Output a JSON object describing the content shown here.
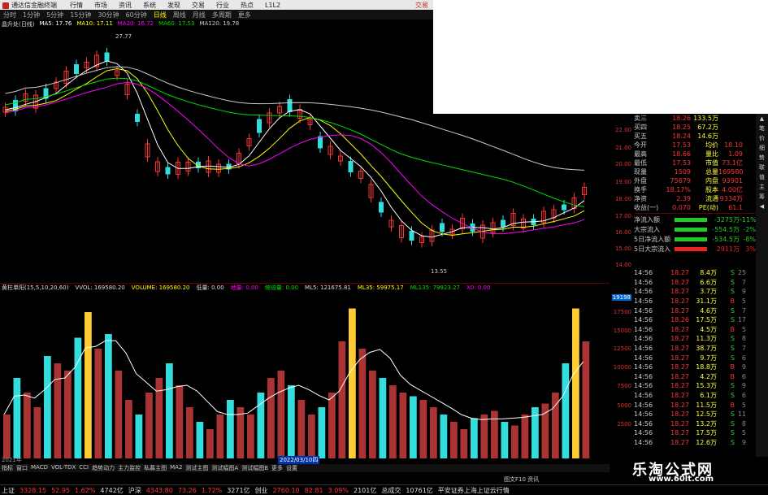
{
  "app": {
    "title": "通达信金融终端",
    "menu": [
      "行情",
      "市场",
      "资讯",
      "系统",
      "发现",
      "交易",
      "行业",
      "热点",
      "L1L2"
    ],
    "trade_label": "交易"
  },
  "periods": [
    "分时",
    "1分钟",
    "5分钟",
    "15分钟",
    "30分钟",
    "60分钟",
    "日线",
    "周线",
    "月线",
    "多周期",
    "更多"
  ],
  "active_period": "日线",
  "ma_legend": {
    "name": "晶升处(日线)",
    "ma5": "MA5: 17.76",
    "ma10": "MA10: 17.11",
    "ma20": "MA20: 16.72",
    "ma60": "MA60: 17.53",
    "ma120": "MA120: 19.78"
  },
  "price_axis": [
    "22.00",
    "21.00",
    "20.00",
    "19.00",
    "18.00",
    "17.00",
    "16.00",
    "15.00",
    "14.00"
  ],
  "chart_labels": {
    "high": "27.77",
    "low": "13.55"
  },
  "volume_header": {
    "name": "黄柱单阳(15,5,10,20,60)",
    "vvol": "VVOL: 169580.20",
    "volume": "VOLUME: 169580.20",
    "low_vol": "低量: 0.00",
    "jump": "地量: 0.00",
    "inc": "缩倍量: 0.00",
    "ml5": "ML5: 121675.81",
    "ml35": "ML35: 59975.17",
    "ml135": "ML135: 79923.27",
    "x0": "X0: 0.00"
  },
  "volume_axis": [
    "17500",
    "15000",
    "12500",
    "10000",
    "7500",
    "5000",
    "2500"
  ],
  "volume_current": "19198",
  "quote": {
    "rows": [
      {
        "l1": "卖三",
        "v1": "18.26",
        "v2": "133.5万",
        "l2": "",
        "v3": ""
      },
      {
        "l1": "买四",
        "v1": "18.25",
        "v2": "67.2万",
        "l2": "",
        "v3": ""
      },
      {
        "l1": "买五",
        "v1": "18.24",
        "v2": "14.6万",
        "l2": "",
        "v3": ""
      },
      {
        "l1": "今开",
        "v1": "17.53",
        "v2": "均价",
        "l2": "",
        "v3": "18.10"
      },
      {
        "l1": "最高",
        "v1": "18.66",
        "v2": "量比",
        "l2": "",
        "v3": "1.09"
      },
      {
        "l1": "最低",
        "v1": "17.53",
        "v2": "市值",
        "l2": "",
        "v3": "73.1亿"
      },
      {
        "l1": "现量",
        "v1": "1509",
        "v2": "总量",
        "l2": "",
        "v3": "169580"
      },
      {
        "l1": "外盘",
        "v1": "75679",
        "v2": "内盘",
        "l2": "",
        "v3": "93901"
      },
      {
        "l1": "换手",
        "v1": "18.17%",
        "v2": "股本",
        "l2": "",
        "v3": "4.00亿"
      },
      {
        "l1": "净资",
        "v1": "2.39",
        "v2": "流通",
        "l2": "",
        "v3": "9334万"
      },
      {
        "l1": "收益(一)",
        "v1": "0.070",
        "v2": "PE(动)",
        "l2": "",
        "v3": "61.1"
      }
    ],
    "flow": [
      {
        "label": "净流入额",
        "value": "-3275万",
        "pct": "-11%",
        "color": "#2c2"
      },
      {
        "label": "大宗流入",
        "value": "-554.5万",
        "pct": "-2%",
        "color": "#2c2"
      },
      {
        "label": "5日净流入额",
        "value": "-534.5万",
        "pct": "-8%",
        "color": "#2c2"
      },
      {
        "label": "5日大宗流入",
        "value": "2911万",
        "pct": "3%",
        "color": "#e22"
      }
    ]
  },
  "ticks": [
    {
      "t": "14:56",
      "p": "18.27",
      "q": "8.4万",
      "d": "S",
      "n": "25"
    },
    {
      "t": "14:56",
      "p": "18.27",
      "q": "6.6万",
      "d": "S",
      "n": "7"
    },
    {
      "t": "14:56",
      "p": "18.27",
      "q": "3.7万",
      "d": "S",
      "n": "9"
    },
    {
      "t": "14:56",
      "p": "18.27",
      "q": "31.1万",
      "d": "B",
      "n": "5"
    },
    {
      "t": "14:56",
      "p": "18.27",
      "q": "4.6万",
      "d": "S",
      "n": "7"
    },
    {
      "t": "14:56",
      "p": "18.26",
      "q": "17.5万",
      "d": "S",
      "n": "17"
    },
    {
      "t": "14:56",
      "p": "18.27",
      "q": "4.5万",
      "d": "B",
      "n": "5"
    },
    {
      "t": "14:56",
      "p": "18.27",
      "q": "11.3万",
      "d": "S",
      "n": "8"
    },
    {
      "t": "14:56",
      "p": "18.27",
      "q": "38.7万",
      "d": "S",
      "n": "7"
    },
    {
      "t": "14:56",
      "p": "18.27",
      "q": "9.7万",
      "d": "S",
      "n": "6"
    },
    {
      "t": "14:56",
      "p": "18.27",
      "q": "18.8万",
      "d": "B",
      "n": "9"
    },
    {
      "t": "14:56",
      "p": "18.27",
      "q": "4.2万",
      "d": "B",
      "n": "6"
    },
    {
      "t": "14:56",
      "p": "18.27",
      "q": "15.3万",
      "d": "S",
      "n": "9"
    },
    {
      "t": "14:56",
      "p": "18.27",
      "q": "6.1万",
      "d": "S",
      "n": "6"
    },
    {
      "t": "14:56",
      "p": "18.27",
      "q": "11.5万",
      "d": "B",
      "n": "5"
    },
    {
      "t": "14:56",
      "p": "18.27",
      "q": "12.5万",
      "d": "S",
      "n": "11"
    },
    {
      "t": "14:56",
      "p": "18.27",
      "q": "13.2万",
      "d": "S",
      "n": "8"
    },
    {
      "t": "14:56",
      "p": "18.27",
      "q": "17.5万",
      "d": "S",
      "n": "5"
    },
    {
      "t": "14:56",
      "p": "18.27",
      "q": "12.6万",
      "d": "S",
      "n": "9"
    }
  ],
  "indicator_tabs": [
    "指标",
    "窗口",
    "MACD",
    "VOL-TDX",
    "CCI",
    "趋势动力",
    "主力监控",
    "私募主图",
    "MA2",
    "测试主图",
    "测试幅图A",
    "测试幅图B",
    "更多",
    "设置"
  ],
  "status_right": "图文F10  资讯",
  "date_strip": {
    "start": "2021年",
    "highlight": "2022/03/10四"
  },
  "index_bar": {
    "sh_label": "上证",
    "sh_value": "3328.15",
    "sh_chg": "52.95",
    "sh_pct": "1.62%",
    "sh_amt": "4742亿",
    "sz_label": "沪深",
    "sz_value": "4343.80",
    "sz_chg": "73.26",
    "sz_pct": "1.72%",
    "sz_amt": "3271亿",
    "cy_label": "创业",
    "cy_value": "2760.10",
    "cy_chg": "82.81",
    "cy_pct": "3.09%",
    "cy_amt": "2101亿",
    "total_label": "总成交",
    "total_value": "10761亿",
    "broker": "平安证券上海上证云行情"
  },
  "brand": {
    "title": "乐淘公式网",
    "url": "www.60lt.com"
  },
  "colors": {
    "up": "#ff3333",
    "down": "#33dddd",
    "ma5": "#ffffff",
    "ma10": "#ffff00",
    "ma20": "#ff00ff",
    "ma60": "#00dd00",
    "ma120": "#cccccc",
    "yellow_bar": "#ffcc33"
  }
}
